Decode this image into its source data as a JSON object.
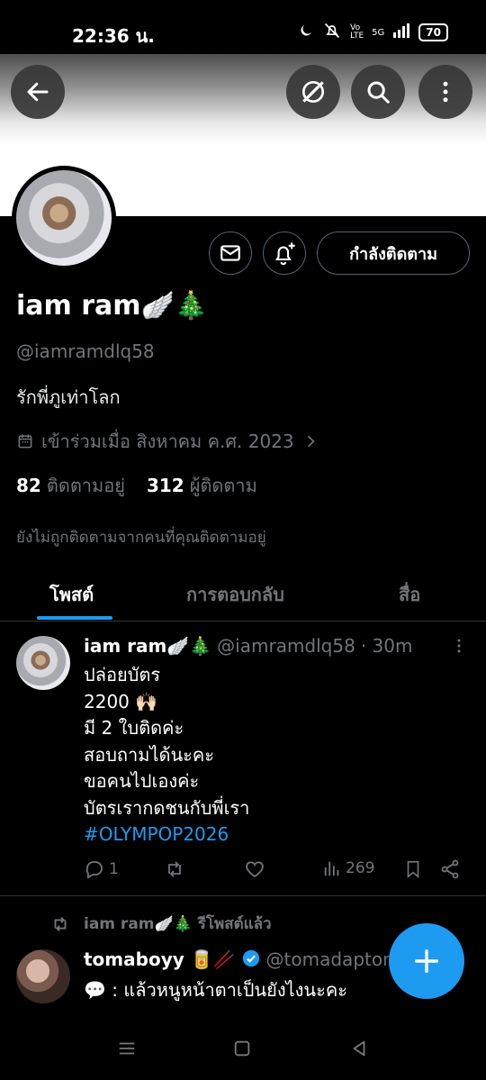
{
  "status": {
    "time": "22:36 น.",
    "battery": "70",
    "net": "5G",
    "volte": "Vo LTE"
  },
  "profile": {
    "name": "iam ram🪽🎄",
    "handle": "@iamramdlq58",
    "bio": "รักพี่ภูเท่าโลก",
    "joined": "เข้าร่วมเมื่อ สิงหาคม ค.ศ. 2023",
    "following_count": "82",
    "following_label": "ติดตามอยู่",
    "followers_count": "312",
    "followers_label": "ผู้ติดตาม",
    "not_followed_note": "ยังไม่ถูกติดตามจากคนที่คุณติดตามอยู่",
    "following_button": "กำลังติดตาม"
  },
  "tabs": [
    "โพสต์",
    "การตอบกลับ",
    "สื่อ"
  ],
  "post": {
    "name": "iam ram🪽🎄",
    "handle": "@iamramdlq58",
    "time": "· 30m",
    "lines": [
      "ปล่อยบัตร",
      "2200 🙌🏻",
      "มี 2 ใบติดค่ะ",
      "สอบถามได้นะคะ",
      "ขอคนไปเองค่ะ",
      "บัตรเรากดชนกับพี่เรา"
    ],
    "hashtag": "#OLYMPOP2026",
    "replies": "1",
    "views": "269"
  },
  "repost": {
    "label": "iam ram🪽🎄 รีโพสต์แล้ว",
    "name": "tomaboyy 🥫🥢",
    "handle": "@tomadaptor",
    "text": "💬 : แล้วหนูหน้าตาเป็นยังไงนะคะ"
  },
  "colors": {
    "accent": "#1d9bf0",
    "muted": "#71767b",
    "border": "#2f3336",
    "verified": "#1d9bf0"
  }
}
